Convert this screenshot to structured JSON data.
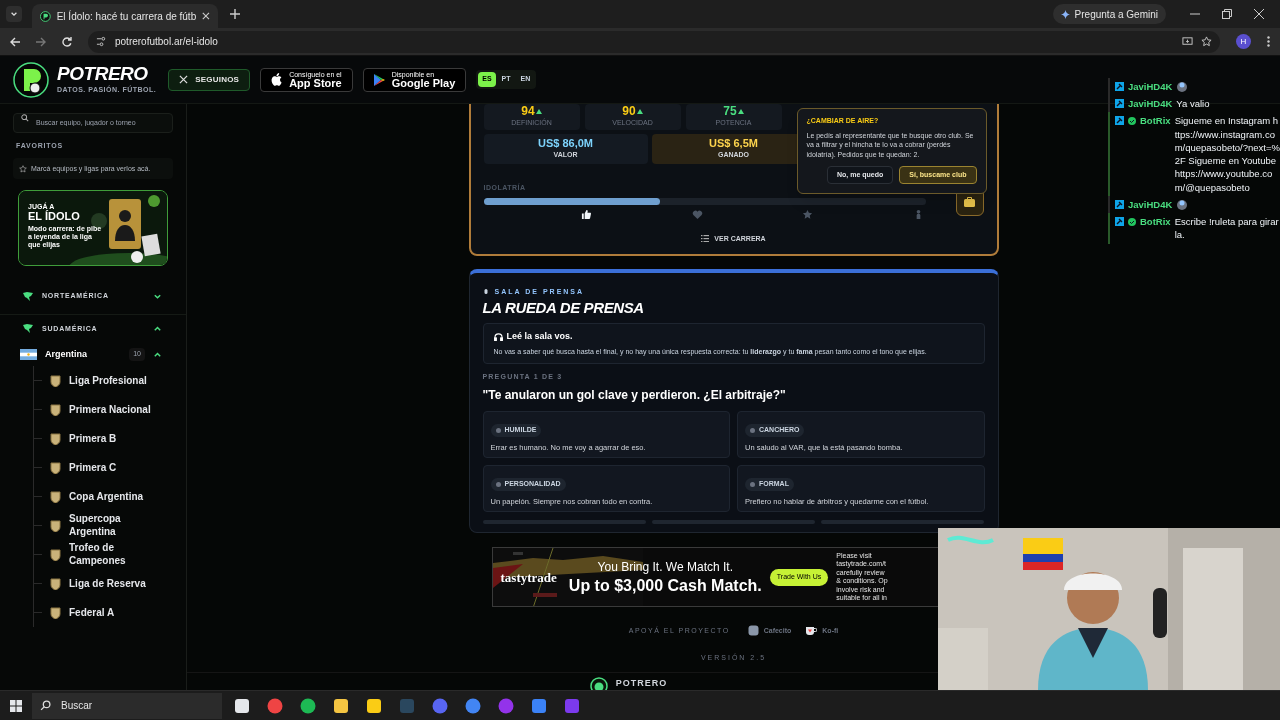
{
  "browser": {
    "tab_title": "El Ídolo: hacé tu carrera de fútb",
    "url": "potrerofutbol.ar/el-idolo",
    "gemini": "Pregunta a Gemini",
    "profile_initial": "H"
  },
  "header": {
    "logo": "POTRERO",
    "tagline": "DATOS. PASIÓN. FÚTBOL.",
    "follow": "SEGUINOS",
    "app_store": {
      "small": "Consíguelo en el",
      "big": "App Store"
    },
    "google_play": {
      "small": "Disponible en",
      "big": "Google Play"
    },
    "languages": [
      {
        "label": "ES",
        "selected": true
      },
      {
        "label": "PT",
        "selected": false
      },
      {
        "label": "EN",
        "selected": false
      }
    ]
  },
  "sidebar": {
    "search_placeholder": "Buscar equipo, jugador o torneo",
    "favorites_title": "FAVORITOS",
    "favorites_empty": "Marcá equipos y ligas para verlos acá.",
    "promo": {
      "kicker": "JUGÁ A",
      "title": "EL ÍDOLO",
      "text": "Modo carrera: de pibe a leyenda de la liga que elijas"
    },
    "regions": [
      {
        "label": "NORTEAMÉRICA",
        "expanded": false
      },
      {
        "label": "SUDAMÉRICA",
        "expanded": true,
        "children": [
          {
            "label": "Argentina",
            "count": "10",
            "expanded": true,
            "children": [
              {
                "label": "Liga Profesional"
              },
              {
                "label": "Primera Nacional"
              },
              {
                "label": "Primera B"
              },
              {
                "label": "Primera C"
              },
              {
                "label": "Copa Argentina"
              },
              {
                "label": "Supercopa Argentina"
              },
              {
                "label": "Trofeo de Campeones"
              },
              {
                "label": "Liga de Reserva"
              },
              {
                "label": "Federal A"
              }
            ]
          }
        ]
      }
    ]
  },
  "career": {
    "stats": [
      {
        "value": "94",
        "label": "DEFINICIÓN",
        "color": "#facc15"
      },
      {
        "value": "90",
        "label": "VELOCIDAD",
        "color": "#facc15"
      },
      {
        "value": "75",
        "label": "POTENCIA",
        "color": "#4ade80"
      }
    ],
    "money": [
      {
        "value": "US$ 86,0M",
        "label": "VALOR",
        "kind": "value"
      },
      {
        "value": "US$ 6,5M",
        "label": "GANADO",
        "kind": "earned"
      }
    ],
    "idolatry": {
      "label": "IDOLATRÍA",
      "level": 0.4,
      "milestones": [
        {
          "kind": "thumb",
          "reached": true
        },
        {
          "kind": "heart",
          "reached": false
        },
        {
          "kind": "star",
          "reached": false
        },
        {
          "kind": "figure",
          "reached": false
        }
      ]
    },
    "view_career": "VER CARRERA",
    "popup": {
      "title": "¿CAMBIAR DE AIRE?",
      "text": "Le pedís al representante que te busque otro club. Se va a filtrar y el hincha te lo va a cobrar (perdés idolatría). Pedidos que te quedan: 2.",
      "cancel": "No, me quedo",
      "confirm": "Sí, buscame club"
    }
  },
  "press": {
    "kicker": "SALA DE PRENSA",
    "title": "LA RUEDA DE PRENSA",
    "info_title": "Leé la sala vos.",
    "info_text": "No vas a saber qué busca hasta el final, y no hay una única respuesta correcta: tu **liderazgo** y tu **fama** pesan tanto como el tono que elijas.",
    "step": "PREGUNTA 1 DE 3",
    "question": "\"Te anularon un gol clave y perdieron. ¿El arbitraje?\"",
    "options": [
      {
        "tag": "HUMILDE",
        "text": "Errar es humano. No me voy a agarrar de eso."
      },
      {
        "tag": "CANCHERO",
        "text": "Un saludo al VAR, que la está pasando bomba."
      },
      {
        "tag": "PERSONALIDAD",
        "text": "Un papelón. Siempre nos cobran todo en contra."
      },
      {
        "tag": "FORMAL",
        "text": "Prefiero no hablar de árbitros y quedarme con el fútbol."
      }
    ]
  },
  "ad": {
    "brand": "tastytrade",
    "line1": "You Bring It. We Match It.",
    "line2": "Up to $3,000 Cash Match.",
    "button": "Trade With Us",
    "disclaimer": [
      "Please visit",
      "tastytrade.com/t",
      "carefully review",
      "& conditions. Op",
      "involve risk and",
      "suitable for all in"
    ]
  },
  "footer": {
    "support": "APOYÁ EL PROYECTO",
    "links": [
      "Cafecito",
      "Ko-fi"
    ],
    "version": "VERSIÓN 2.5",
    "logo": "POTRERO"
  },
  "chat": [
    {
      "user": "JaviHD4K",
      "verified": false,
      "emote": true
    },
    {
      "user": "JaviHD4K",
      "verified": false,
      "emote": false,
      "text": "Ya valio"
    },
    {
      "user": "BotRix",
      "verified": true,
      "emote": false,
      "text": "Sigueme en Instagram https://www.instagram.com/quepasobeto/?next=%2F Sigueme en Youtube https://www.youtube.com/@quepasobeto"
    },
    {
      "user": "JaviHD4K",
      "verified": false,
      "emote": true
    },
    {
      "user": "BotRix",
      "verified": true,
      "emote": false,
      "text": "Escribe !ruleta para girarla."
    }
  ],
  "taskbar": {
    "search": "Buscar"
  }
}
